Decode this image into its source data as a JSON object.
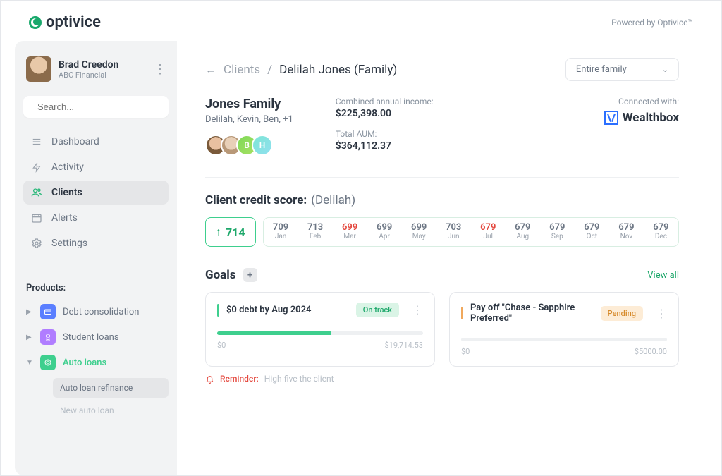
{
  "header": {
    "brand": "optivice",
    "powered": "Powered by Optivice™"
  },
  "user": {
    "name": "Brad Creedon",
    "org": "ABC Financial"
  },
  "search": {
    "placeholder": "Search..."
  },
  "nav": [
    {
      "label": "Dashboard"
    },
    {
      "label": "Activity"
    },
    {
      "label": "Clients"
    },
    {
      "label": "Alerts"
    },
    {
      "label": "Settings"
    }
  ],
  "products": {
    "heading": "Products:",
    "items": [
      {
        "label": "Debt consolidation"
      },
      {
        "label": "Student loans"
      },
      {
        "label": "Auto loans"
      }
    ],
    "sub": [
      {
        "label": "Auto loan refinance"
      },
      {
        "label": "New auto loan"
      }
    ]
  },
  "breadcrumb": {
    "back": "←",
    "section": "Clients",
    "current": "Delilah Jones (Family)",
    "select": "Entire family"
  },
  "family": {
    "title": "Jones Family",
    "members": "Delilah, Kevin, Ben, +1",
    "badges": {
      "b": "B",
      "h": "H"
    },
    "income_label": "Combined annual income:",
    "income": "$225,398.00",
    "aum_label": "Total AUM:",
    "aum": "$364,112.37",
    "connected_label": "Connected with:",
    "integration": "Wealthbox"
  },
  "credit": {
    "title": "Client credit score:",
    "who": "(Delilah)",
    "current": "714",
    "history": [
      {
        "v": "709",
        "m": "Jan"
      },
      {
        "v": "713",
        "m": "Feb"
      },
      {
        "v": "699",
        "m": "Mar",
        "red": true
      },
      {
        "v": "699",
        "m": "Apr"
      },
      {
        "v": "699",
        "m": "May"
      },
      {
        "v": "703",
        "m": "Jun"
      },
      {
        "v": "679",
        "m": "Jul",
        "red": true
      },
      {
        "v": "679",
        "m": "Aug"
      },
      {
        "v": "679",
        "m": "Sep"
      },
      {
        "v": "679",
        "m": "Oct"
      },
      {
        "v": "679",
        "m": "Nov"
      },
      {
        "v": "679",
        "m": "Dec"
      }
    ]
  },
  "goals": {
    "title": "Goals",
    "view_all": "View all",
    "cards": [
      {
        "title": "$0 debt by Aug 2024",
        "status": "On track",
        "badge_class": "green",
        "progress_pct": 55,
        "min": "$0",
        "max": "$19,714.53"
      },
      {
        "title": "Pay off \"Chase - Sapphire Preferred\"",
        "status": "Pending",
        "badge_class": "orange",
        "progress_pct": 0,
        "min": "$0",
        "max": "$5000.00"
      }
    ],
    "reminder_label": "Reminder:",
    "reminder_text": "High-five the client"
  }
}
